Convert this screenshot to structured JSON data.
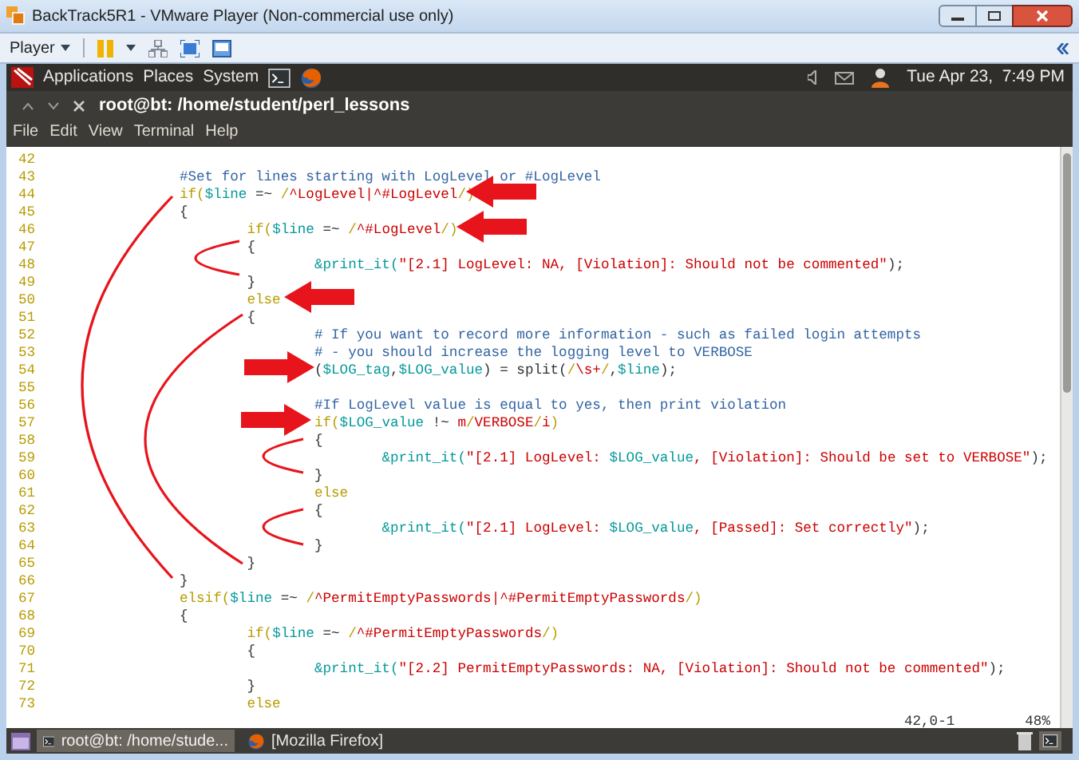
{
  "window": {
    "title": "BackTrack5R1 - VMware Player (Non-commercial use only)"
  },
  "toolbar": {
    "player_menu": "Player"
  },
  "panel": {
    "menus": [
      "Applications",
      "Places",
      "System"
    ],
    "clock": "Tue Apr 23,  7:49 PM"
  },
  "terminal": {
    "title": "root@bt: /home/student/perl_lessons",
    "menu": [
      "File",
      "Edit",
      "View",
      "Terminal",
      "Help"
    ],
    "lines": [
      {
        "number": "42"
      },
      {
        "number": "43",
        "segments": [
          {
            "kind": "comment",
            "text": "\t\t#Set for lines starting with LogLevel or #LogLevel"
          }
        ]
      },
      {
        "number": "44",
        "segments": [
          {
            "kind": "keyword",
            "text": "\t\tif("
          },
          {
            "kind": "variable",
            "text": "$line"
          },
          {
            "kind": "plain",
            "text": " =~ "
          },
          {
            "kind": "delimiter",
            "text": "/"
          },
          {
            "kind": "string",
            "text": "^LogLevel|^#LogLevel"
          },
          {
            "kind": "delimiter",
            "text": "/"
          },
          {
            "kind": "keyword",
            "text": ")"
          }
        ]
      },
      {
        "number": "45",
        "segments": [
          {
            "kind": "plain",
            "text": "\t\t{"
          }
        ]
      },
      {
        "number": "46",
        "segments": [
          {
            "kind": "keyword",
            "text": "\t\t\tif("
          },
          {
            "kind": "variable",
            "text": "$line"
          },
          {
            "kind": "plain",
            "text": " =~ "
          },
          {
            "kind": "delimiter",
            "text": "/"
          },
          {
            "kind": "string",
            "text": "^#LogLevel"
          },
          {
            "kind": "delimiter",
            "text": "/"
          },
          {
            "kind": "keyword",
            "text": ")"
          }
        ]
      },
      {
        "number": "47",
        "segments": [
          {
            "kind": "plain",
            "text": "\t\t\t{"
          }
        ]
      },
      {
        "number": "48",
        "segments": [
          {
            "kind": "variable",
            "text": "\t\t\t\t&print_it("
          },
          {
            "kind": "string",
            "text": "\"[2.1] LogLevel: NA, [Violation]: Should not be commented\""
          },
          {
            "kind": "plain",
            "text": ");"
          }
        ]
      },
      {
        "number": "49",
        "segments": [
          {
            "kind": "plain",
            "text": "\t\t\t}"
          }
        ]
      },
      {
        "number": "50",
        "segments": [
          {
            "kind": "keyword",
            "text": "\t\t\telse"
          }
        ]
      },
      {
        "number": "51",
        "segments": [
          {
            "kind": "plain",
            "text": "\t\t\t{"
          }
        ]
      },
      {
        "number": "52",
        "segments": [
          {
            "kind": "comment",
            "text": "\t\t\t\t# If you want to record more information - such as failed login attempts"
          }
        ]
      },
      {
        "number": "53",
        "segments": [
          {
            "kind": "comment",
            "text": "\t\t\t\t# - you should increase the logging level to VERBOSE"
          }
        ]
      },
      {
        "number": "54",
        "segments": [
          {
            "kind": "plain",
            "text": "\t\t\t\t("
          },
          {
            "kind": "variable",
            "text": "$LOG_tag"
          },
          {
            "kind": "plain",
            "text": ","
          },
          {
            "kind": "variable",
            "text": "$LOG_value"
          },
          {
            "kind": "plain",
            "text": ") = split("
          },
          {
            "kind": "delimiter",
            "text": "/"
          },
          {
            "kind": "string",
            "text": "\\s+"
          },
          {
            "kind": "delimiter",
            "text": "/"
          },
          {
            "kind": "plain",
            "text": ","
          },
          {
            "kind": "variable",
            "text": "$line"
          },
          {
            "kind": "plain",
            "text": ");"
          }
        ]
      },
      {
        "number": "55"
      },
      {
        "number": "56",
        "segments": [
          {
            "kind": "comment",
            "text": "\t\t\t\t#If LogLevel value is equal to yes, then print violation"
          }
        ]
      },
      {
        "number": "57",
        "segments": [
          {
            "kind": "keyword",
            "text": "\t\t\t\tif("
          },
          {
            "kind": "variable",
            "text": "$LOG_value"
          },
          {
            "kind": "plain",
            "text": " !~ "
          },
          {
            "kind": "string",
            "text": "m"
          },
          {
            "kind": "delimiter",
            "text": "/"
          },
          {
            "kind": "string",
            "text": "VERBOSE"
          },
          {
            "kind": "delimiter",
            "text": "/"
          },
          {
            "kind": "string",
            "text": "i"
          },
          {
            "kind": "keyword",
            "text": ")"
          }
        ]
      },
      {
        "number": "58",
        "segments": [
          {
            "kind": "plain",
            "text": "\t\t\t\t{"
          }
        ]
      },
      {
        "number": "59",
        "segments": [
          {
            "kind": "variable",
            "text": "\t\t\t\t\t&print_it("
          },
          {
            "kind": "string",
            "text": "\"[2.1] LogLevel: "
          },
          {
            "kind": "variable",
            "text": "$LOG_value"
          },
          {
            "kind": "string",
            "text": ", [Violation]: Should be set to VERBOSE\""
          },
          {
            "kind": "plain",
            "text": ");"
          }
        ]
      },
      {
        "number": "60",
        "segments": [
          {
            "kind": "plain",
            "text": "\t\t\t\t}"
          }
        ]
      },
      {
        "number": "61",
        "segments": [
          {
            "kind": "keyword",
            "text": "\t\t\t\telse"
          }
        ]
      },
      {
        "number": "62",
        "segments": [
          {
            "kind": "plain",
            "text": "\t\t\t\t{"
          }
        ]
      },
      {
        "number": "63",
        "segments": [
          {
            "kind": "variable",
            "text": "\t\t\t\t\t&print_it("
          },
          {
            "kind": "string",
            "text": "\"[2.1] LogLevel: "
          },
          {
            "kind": "variable",
            "text": "$LOG_value"
          },
          {
            "kind": "string",
            "text": ", [Passed]: Set correctly\""
          },
          {
            "kind": "plain",
            "text": ");"
          }
        ]
      },
      {
        "number": "64",
        "segments": [
          {
            "kind": "plain",
            "text": "\t\t\t\t}"
          }
        ]
      },
      {
        "number": "65",
        "segments": [
          {
            "kind": "plain",
            "text": "\t\t\t}"
          }
        ]
      },
      {
        "number": "66",
        "segments": [
          {
            "kind": "plain",
            "text": "\t\t}"
          }
        ]
      },
      {
        "number": "67",
        "segments": [
          {
            "kind": "keyword",
            "text": "\t\telsif("
          },
          {
            "kind": "variable",
            "text": "$line"
          },
          {
            "kind": "plain",
            "text": " =~ "
          },
          {
            "kind": "delimiter",
            "text": "/"
          },
          {
            "kind": "string",
            "text": "^PermitEmptyPasswords|^#PermitEmptyPasswords"
          },
          {
            "kind": "delimiter",
            "text": "/"
          },
          {
            "kind": "keyword",
            "text": ")"
          }
        ]
      },
      {
        "number": "68",
        "segments": [
          {
            "kind": "plain",
            "text": "\t\t{"
          }
        ]
      },
      {
        "number": "69",
        "segments": [
          {
            "kind": "keyword",
            "text": "\t\t\tif("
          },
          {
            "kind": "variable",
            "text": "$line"
          },
          {
            "kind": "plain",
            "text": " =~ "
          },
          {
            "kind": "delimiter",
            "text": "/"
          },
          {
            "kind": "string",
            "text": "^#PermitEmptyPasswords"
          },
          {
            "kind": "delimiter",
            "text": "/"
          },
          {
            "kind": "keyword",
            "text": ")"
          }
        ]
      },
      {
        "number": "70",
        "segments": [
          {
            "kind": "plain",
            "text": "\t\t\t{"
          }
        ]
      },
      {
        "number": "71",
        "segments": [
          {
            "kind": "variable",
            "text": "\t\t\t\t&print_it("
          },
          {
            "kind": "string",
            "text": "\"[2.2] PermitEmptyPasswords: NA, [Violation]: Should not be commented\""
          },
          {
            "kind": "plain",
            "text": ");"
          }
        ]
      },
      {
        "number": "72",
        "segments": [
          {
            "kind": "plain",
            "text": "\t\t\t}"
          }
        ]
      },
      {
        "number": "73",
        "segments": [
          {
            "kind": "keyword",
            "text": "\t\t\telse"
          }
        ]
      }
    ],
    "status": {
      "position": "42,0-1",
      "percent": "48%"
    }
  },
  "taskbar": {
    "items": [
      {
        "kind": "terminal",
        "label": "root@bt: /home/stude...",
        "selected": true
      },
      {
        "kind": "browser",
        "label": "[Mozilla Firefox]",
        "selected": false
      }
    ]
  }
}
